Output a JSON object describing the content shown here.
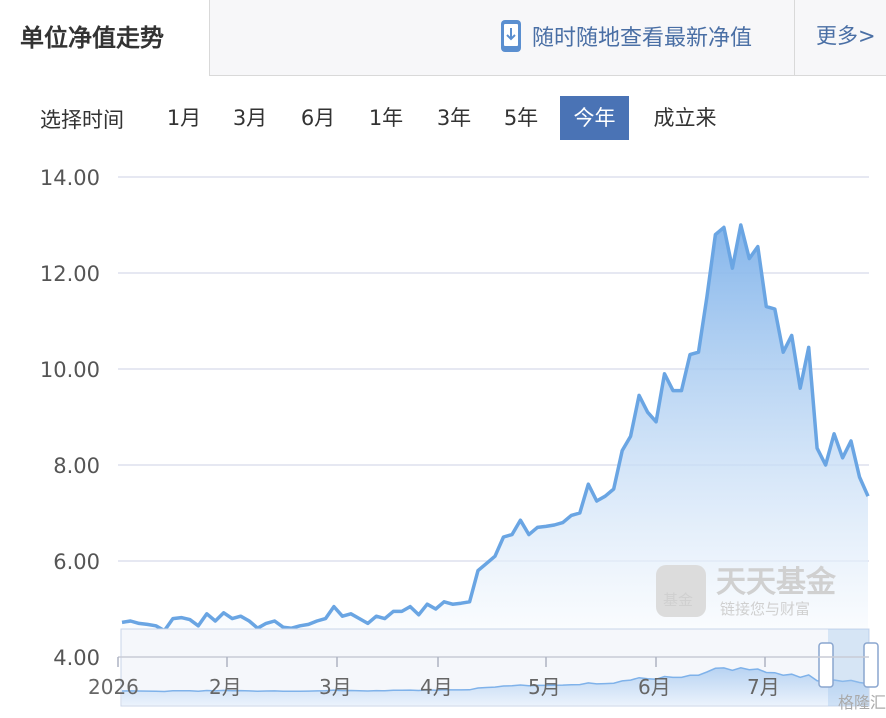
{
  "header": {
    "title": "单位净值走势",
    "mobile_link": "随时随地查看最新净值",
    "mobile_icon": "phone-download-icon",
    "more_link": "更多>"
  },
  "range": {
    "label": "选择时间",
    "options": [
      "1月",
      "3月",
      "6月",
      "1年",
      "3年",
      "5年",
      "今年",
      "成立来"
    ],
    "selected": "今年"
  },
  "colors": {
    "accent": "#4a73b5",
    "line": "#6aa5e3",
    "area_top": "#7fb2ea",
    "area_bottom": "#ffffff",
    "grid": "#dde0ee"
  },
  "watermark": {
    "logo_text": "天天基金",
    "logo_sub": "链接您与财富",
    "badge": "基金",
    "source": "格隆汇"
  },
  "chart_data": {
    "type": "area",
    "ylim": [
      4,
      14
    ],
    "yticks": [
      "4.00",
      "6.00",
      "8.00",
      "10.00",
      "12.00",
      "14.00"
    ],
    "xticks": [
      "2026",
      "2月",
      "3月",
      "4月",
      "5月",
      "6月",
      "7月"
    ],
    "grid": true,
    "series": [
      {
        "values": [
          4.72,
          4.75,
          4.7,
          4.68,
          4.65,
          4.55,
          4.8,
          4.82,
          4.78,
          4.65,
          4.9,
          4.75,
          4.92,
          4.8,
          4.85,
          4.75,
          4.6,
          4.7,
          4.75,
          4.62,
          4.6,
          4.65,
          4.68,
          4.75,
          4.8,
          5.05,
          4.85,
          4.9,
          4.8,
          4.7,
          4.85,
          4.8,
          4.95,
          4.95,
          5.05,
          4.88,
          5.1,
          5.0,
          5.15,
          5.1,
          5.12,
          5.15,
          5.8,
          5.95,
          6.1,
          6.5,
          6.55,
          6.85,
          6.55,
          6.7,
          6.72,
          6.75,
          6.8,
          6.95,
          7.0,
          7.6,
          7.25,
          7.35,
          7.5,
          8.3,
          8.6,
          9.45,
          9.1,
          8.9,
          9.9,
          9.55,
          9.55,
          10.3,
          10.35,
          11.5,
          12.8,
          12.95,
          12.1,
          13.0,
          12.3,
          12.55,
          11.3,
          11.25,
          10.35,
          10.7,
          9.6,
          10.45,
          8.35,
          8.0,
          8.65,
          8.15,
          8.5,
          7.75,
          7.35
        ]
      }
    ]
  }
}
